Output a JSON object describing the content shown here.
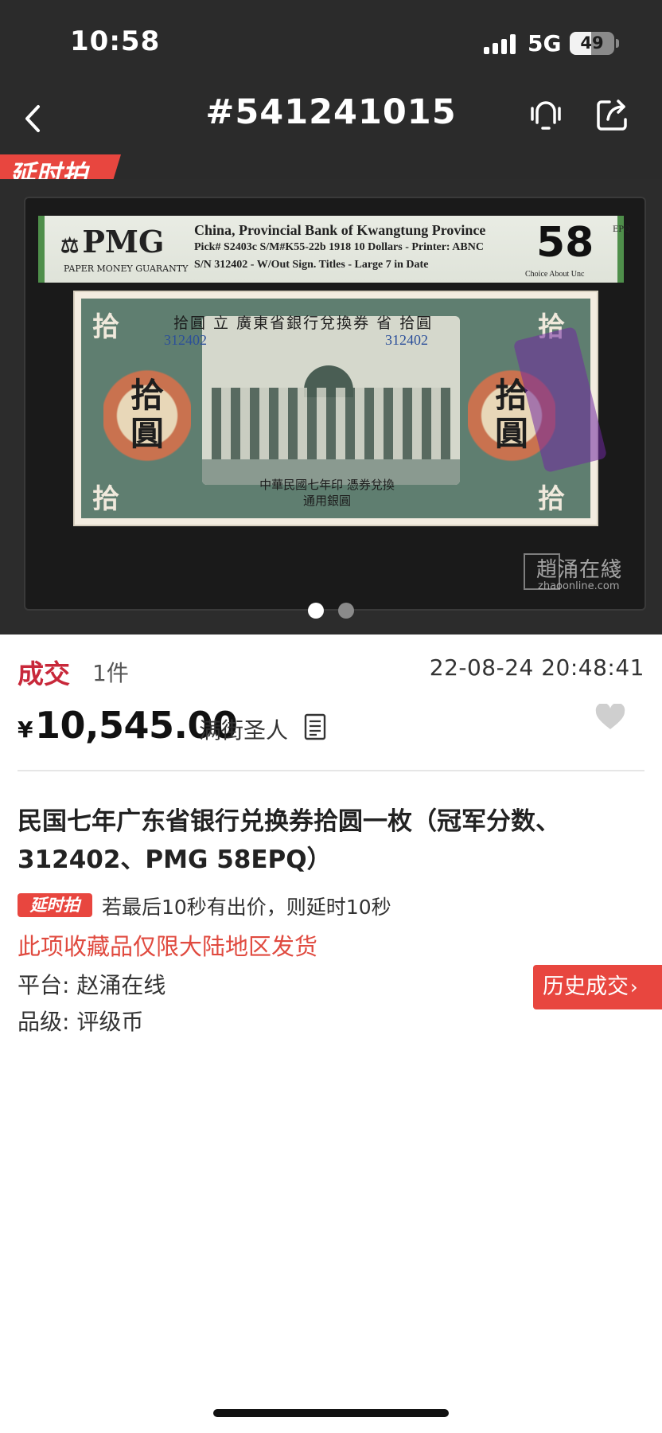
{
  "status_bar": {
    "time": "10:58",
    "network": "5G",
    "battery": "49",
    "battery_level": 0.49
  },
  "header": {
    "title": "#541241015",
    "back_icon": "chevron-left-icon",
    "bell_icon": "bell-icon",
    "share_icon": "share-icon"
  },
  "carousel": {
    "badge": "延时拍",
    "slides_total": 2,
    "active_slide": 1,
    "pmg": {
      "logo": "PMG",
      "logo_sub": "PAPER MONEY GUARANTY",
      "line1": "China, Provincial Bank of Kwangtung Province",
      "line2": "Pick# S2403c  S/M#K55-22b  1918  10 Dollars - Printer: ABNC",
      "line3": "S/N 312402 - W/Out Sign. Titles - Large 7 in Date",
      "grade": "58",
      "grade_suffix": "EPQ",
      "grade_desc": "Choice About Unc"
    },
    "note": {
      "header": "拾圓 立 廣東省銀行兌換券 省 拾圓",
      "serial": "312402",
      "value_chars": "拾圓",
      "corner": "拾",
      "bottom_text": "中華民國七年印 憑券兌換通用銀圓"
    },
    "watermark": "趙涌在綫",
    "watermark_url": "zhaoonline.com"
  },
  "deal": {
    "status": "成交",
    "quantity": "1件",
    "time": "22-08-24 20:48:41",
    "currency_symbol": "¥",
    "price": "10,545.00",
    "buyer": "满街圣人",
    "doc_icon": "document-icon",
    "heart_icon": "heart-icon"
  },
  "item": {
    "title": "民国七年广东省银行兑换券拾圆一枚（冠军分数、312402、PMG 58EPQ）",
    "delay_tag": "延时拍",
    "delay_note": "若最后10秒有出价，则延时10秒",
    "region_note": "此项收藏品仅限大陆地区发货",
    "platform": "平台: 赵涌在线",
    "grade": "品级: 评级币",
    "history_button": "历史成交",
    "history_chevron": "›"
  },
  "colors": {
    "accent_red": "#e8463f",
    "status_red": "#c8283a",
    "dark_header": "#2b2b2b"
  }
}
